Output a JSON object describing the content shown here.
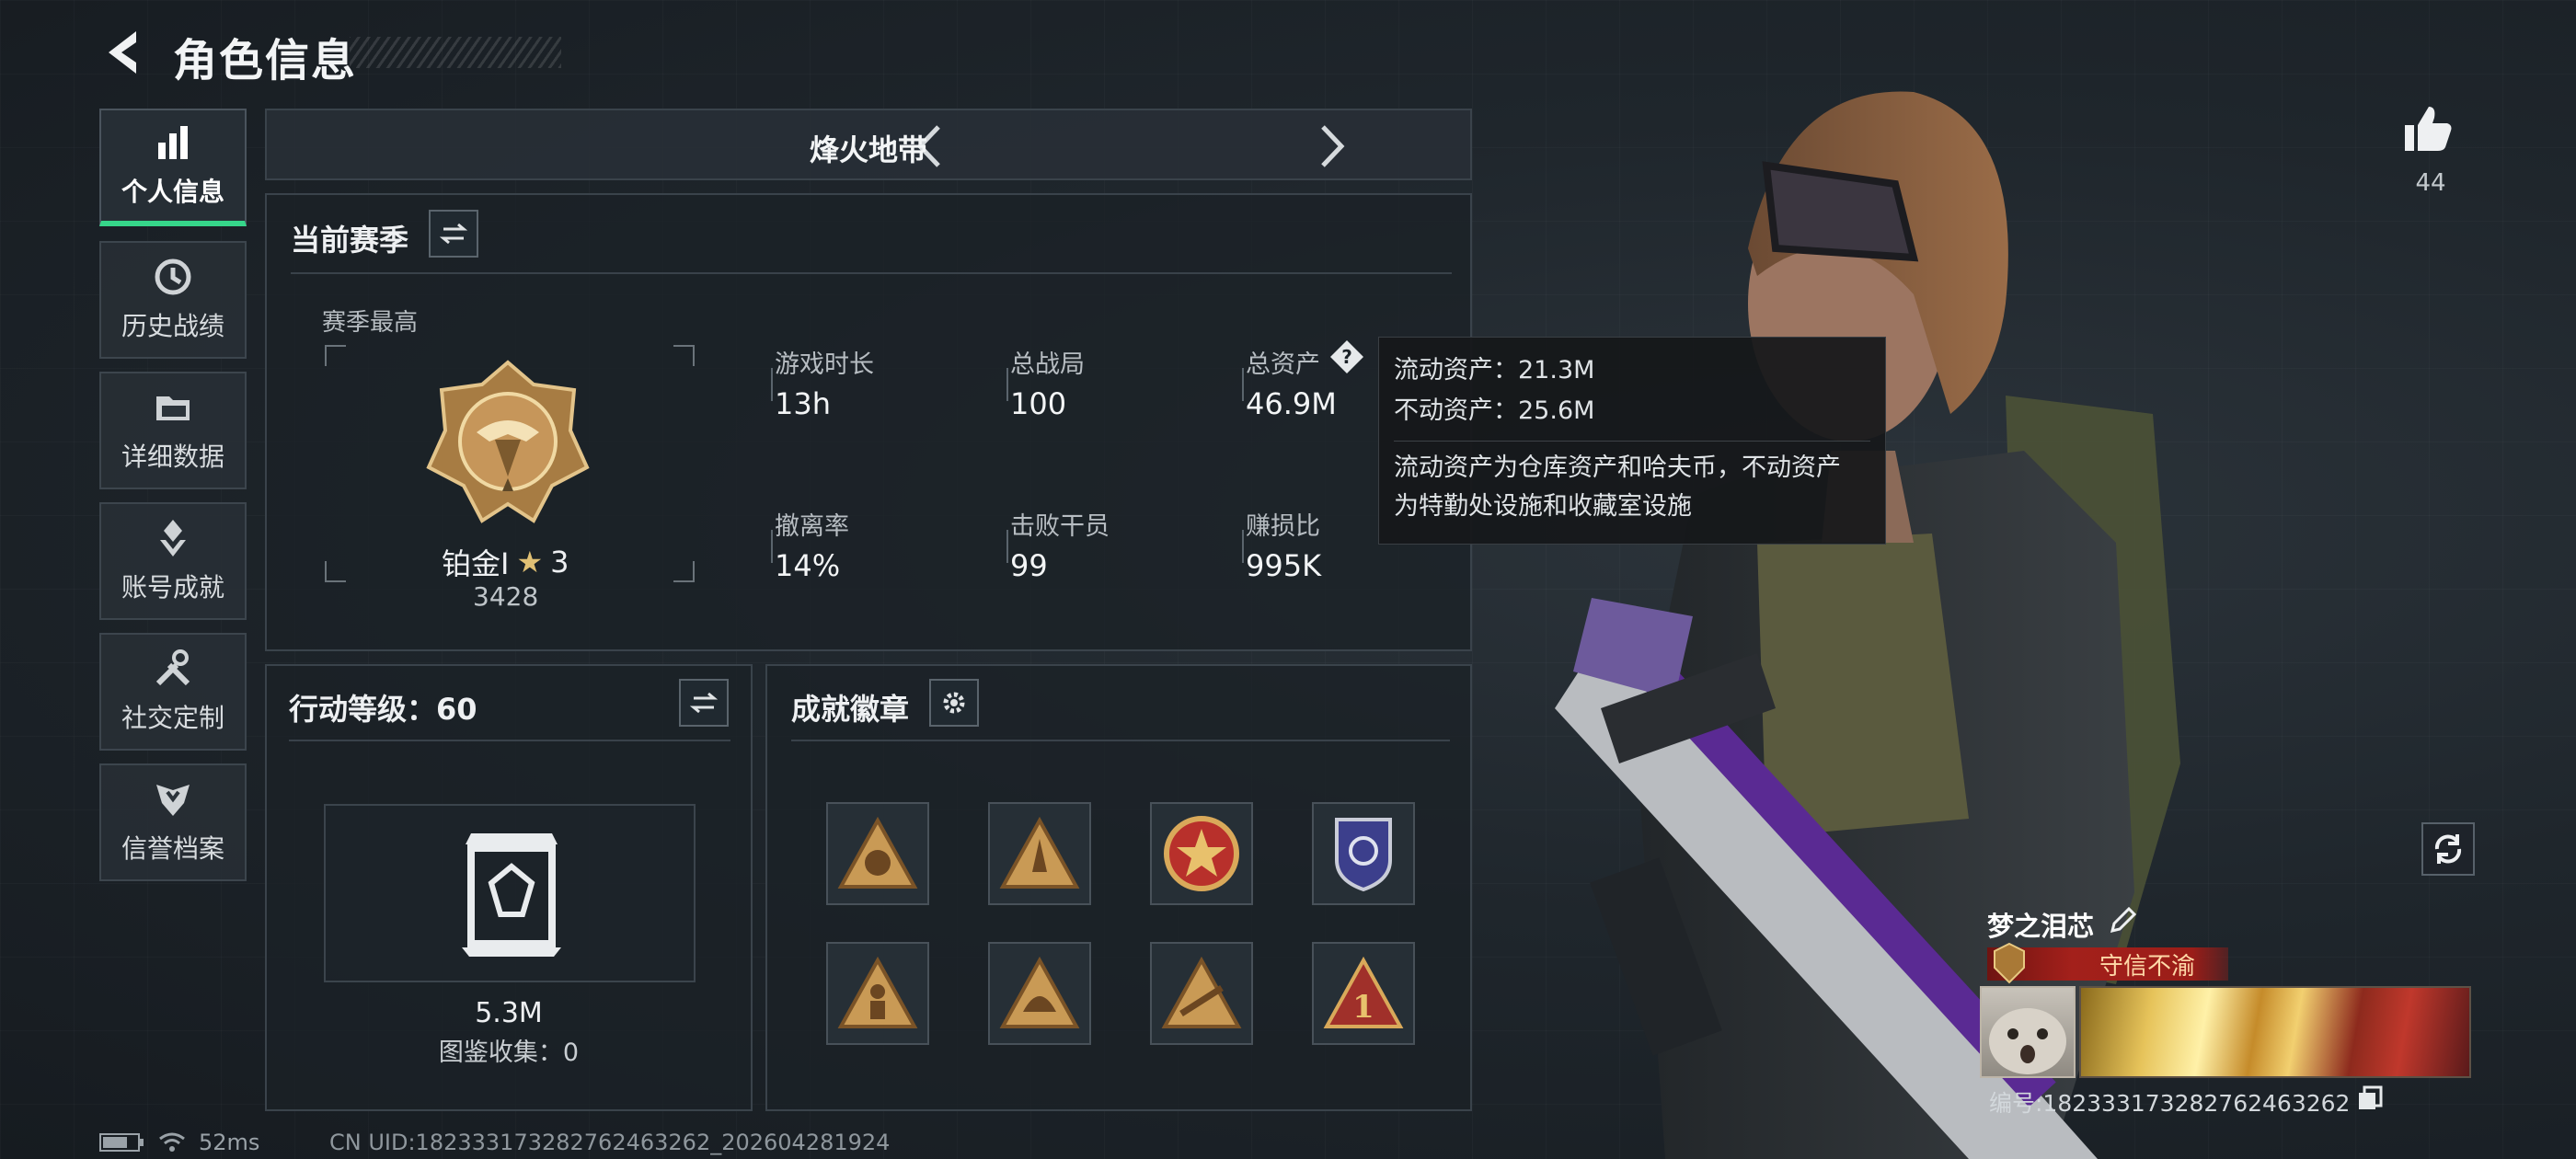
{
  "header": {
    "title": "角色信息"
  },
  "nav": {
    "items": [
      {
        "label": "个人信息",
        "icon": "bar-chart-icon",
        "active": true
      },
      {
        "label": "历史战绩",
        "icon": "history-clock-icon",
        "active": false
      },
      {
        "label": "详细数据",
        "icon": "folder-icon",
        "active": false
      },
      {
        "label": "账号成就",
        "icon": "achievement-icon",
        "active": false
      },
      {
        "label": "社交定制",
        "icon": "tools-icon",
        "active": false
      },
      {
        "label": "信誉档案",
        "icon": "credit-shield-icon",
        "active": false
      }
    ]
  },
  "mode": {
    "name": "烽火地带"
  },
  "season": {
    "title": "当前赛季",
    "best_label": "赛季最高",
    "rank_name": "铂金I",
    "rank_stars": "3",
    "rank_score": "3428",
    "stats": [
      {
        "label": "游戏时长",
        "value": "13h"
      },
      {
        "label": "总战局",
        "value": "100"
      },
      {
        "label": "总资产",
        "value": "46.9M"
      },
      {
        "label": "撤离率",
        "value": "14%"
      },
      {
        "label": "击败干员",
        "value": "99"
      },
      {
        "label": "赚损比",
        "value": "995K"
      }
    ]
  },
  "tooltip": {
    "line1": "流动资产：21.3M",
    "line2": "不动资产：25.6M",
    "desc1": "流动资产为仓库资产和哈夫币，不动资产",
    "desc2": "为特勤处设施和收藏室设施"
  },
  "level": {
    "title": "行动等级：60",
    "value": "5.3M",
    "collection": "图鉴收集：0"
  },
  "badges": {
    "title": "成就徽章",
    "items": [
      "triangle-badge-icon",
      "rocket-badge-icon",
      "star-medal-icon",
      "shield-badge-icon",
      "soldier-badge-icon",
      "helmet-badge-icon",
      "rifle-badge-icon",
      "number-one-badge-icon"
    ]
  },
  "profile": {
    "likes": "44",
    "name": "梦之泪芯",
    "title_tag": "守信不渝",
    "id_label": "编号:182333173282762463262"
  },
  "status": {
    "ping": "52ms",
    "uid": "CN UID:182333173282762463262_202604281924"
  },
  "colors": {
    "accent": "#36d68a",
    "tag": "#a3201b",
    "gold": "#c9a15a"
  }
}
